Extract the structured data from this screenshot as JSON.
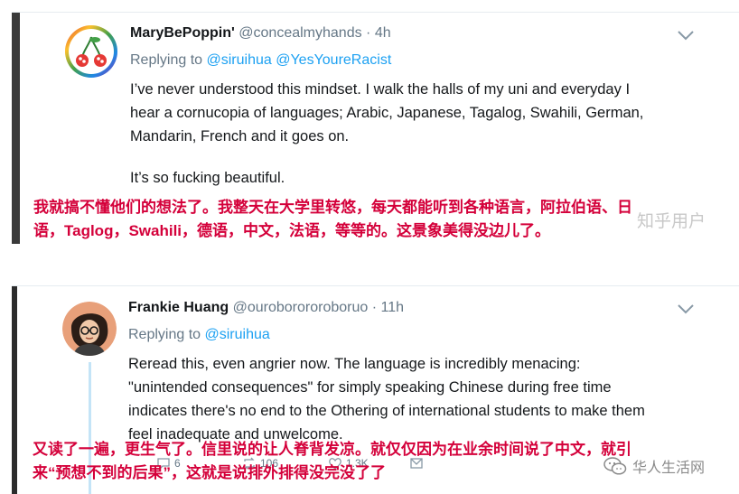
{
  "tweet1": {
    "display_name": "MaryBePoppin'",
    "handle": "@concealmyhands",
    "separator": "·",
    "time": "4h",
    "replying_prefix": "Replying to",
    "replying_to": [
      "@siruihua",
      "@YesYoureRacist"
    ],
    "body_lines": [
      "I’ve never understood this mindset. I walk the halls of my uni and everyday I",
      "hear a cornucopia of languages; Arabic, Japanese, Tagalog, Swahili, German,",
      "Mandarin, French and it goes on."
    ],
    "body_tail": "It’s so fucking beautiful.",
    "translation_lines": [
      "我就搞不懂他们的想法了。我整天在大学里转悠，每天都能听到各种语言，阿拉伯语、日",
      "语，Taglog，Swahili，德语，中文，法语，等等的。这景象美得没边儿了。"
    ],
    "watermark": "知乎用户"
  },
  "tweet2": {
    "display_name": "Frankie Huang",
    "handle": "@ouroborororoboruo",
    "separator": "·",
    "time": "11h",
    "replying_prefix": "Replying to",
    "replying_to": [
      "@siruihua"
    ],
    "body_lines": [
      "Reread this, even angrier now. The language is incredibly menacing:",
      "\"unintended consequences\" for simply speaking Chinese during free time",
      "indicates there's no end to the Othering of international students to make them",
      "feel inadequate and unwelcome."
    ],
    "translation_lines": [
      "又读了一遍，更生气了。信里说的让人脊背发凉。就仅仅因为在业余时间说了中文，就引",
      "来“预想不到的后果”，这就是说排外排得没完没了了"
    ],
    "actions": {
      "reply_count": "6",
      "retweet_count": "106",
      "like_count": "1.3K"
    },
    "watermark": "华人生活网"
  },
  "colors": {
    "link": "#1da1f2",
    "translation": "#d4003a",
    "muted": "#657786"
  },
  "icons": [
    "cherry-avatar",
    "person-avatar",
    "chevron-down-icon",
    "reply-icon",
    "retweet-icon",
    "like-icon",
    "message-icon",
    "wechat-icon"
  ]
}
